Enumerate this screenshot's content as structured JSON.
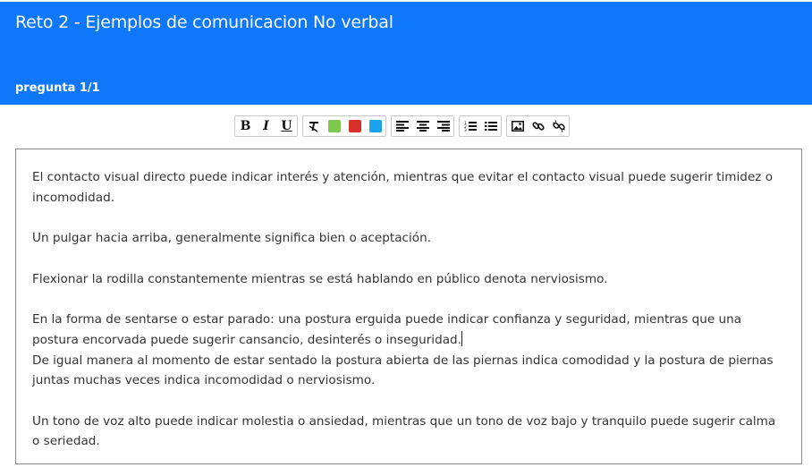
{
  "header": {
    "title": "Reto 2 - Ejemplos de comunicacion No verbal",
    "question_label": "pregunta",
    "question_count": "1/1"
  },
  "toolbar": {
    "bold": "B",
    "italic": "I",
    "underline": "U",
    "colors": {
      "green": "#7ec850",
      "red": "#d8312a",
      "blue": "#1aa3e8"
    },
    "icons": [
      "clear-format-icon",
      "align-left-icon",
      "align-center-icon",
      "align-right-icon",
      "numbered-list-icon",
      "bullet-list-icon",
      "image-icon",
      "link-icon",
      "unlink-icon"
    ]
  },
  "editor": {
    "paragraphs": [
      "El contacto visual directo puede indicar interés y atención, mientras que evitar el contacto visual puede sugerir timidez o incomodidad.",
      "Un pulgar hacia arriba,  generalmente significa bien o aceptación.",
      "Flexionar la rodilla constantemente mientras se está hablando en público denota nerviosismo.",
      "En la forma de sentarse o estar parado: una postura erguida puede indicar confianza y seguridad, mientras que una postura encorvada puede sugerir cansancio, desinterés o inseguridad.",
      "De igual manera al momento de estar sentado la postura abierta de las piernas indica comodidad y la postura de piernas juntas muchas veces indica incomodidad o nerviosismo.",
      "Un tono de voz alto puede indicar molestia o ansiedad, mientras que un tono de voz bajo y tranquilo puede sugerir calma o seriedad."
    ]
  }
}
